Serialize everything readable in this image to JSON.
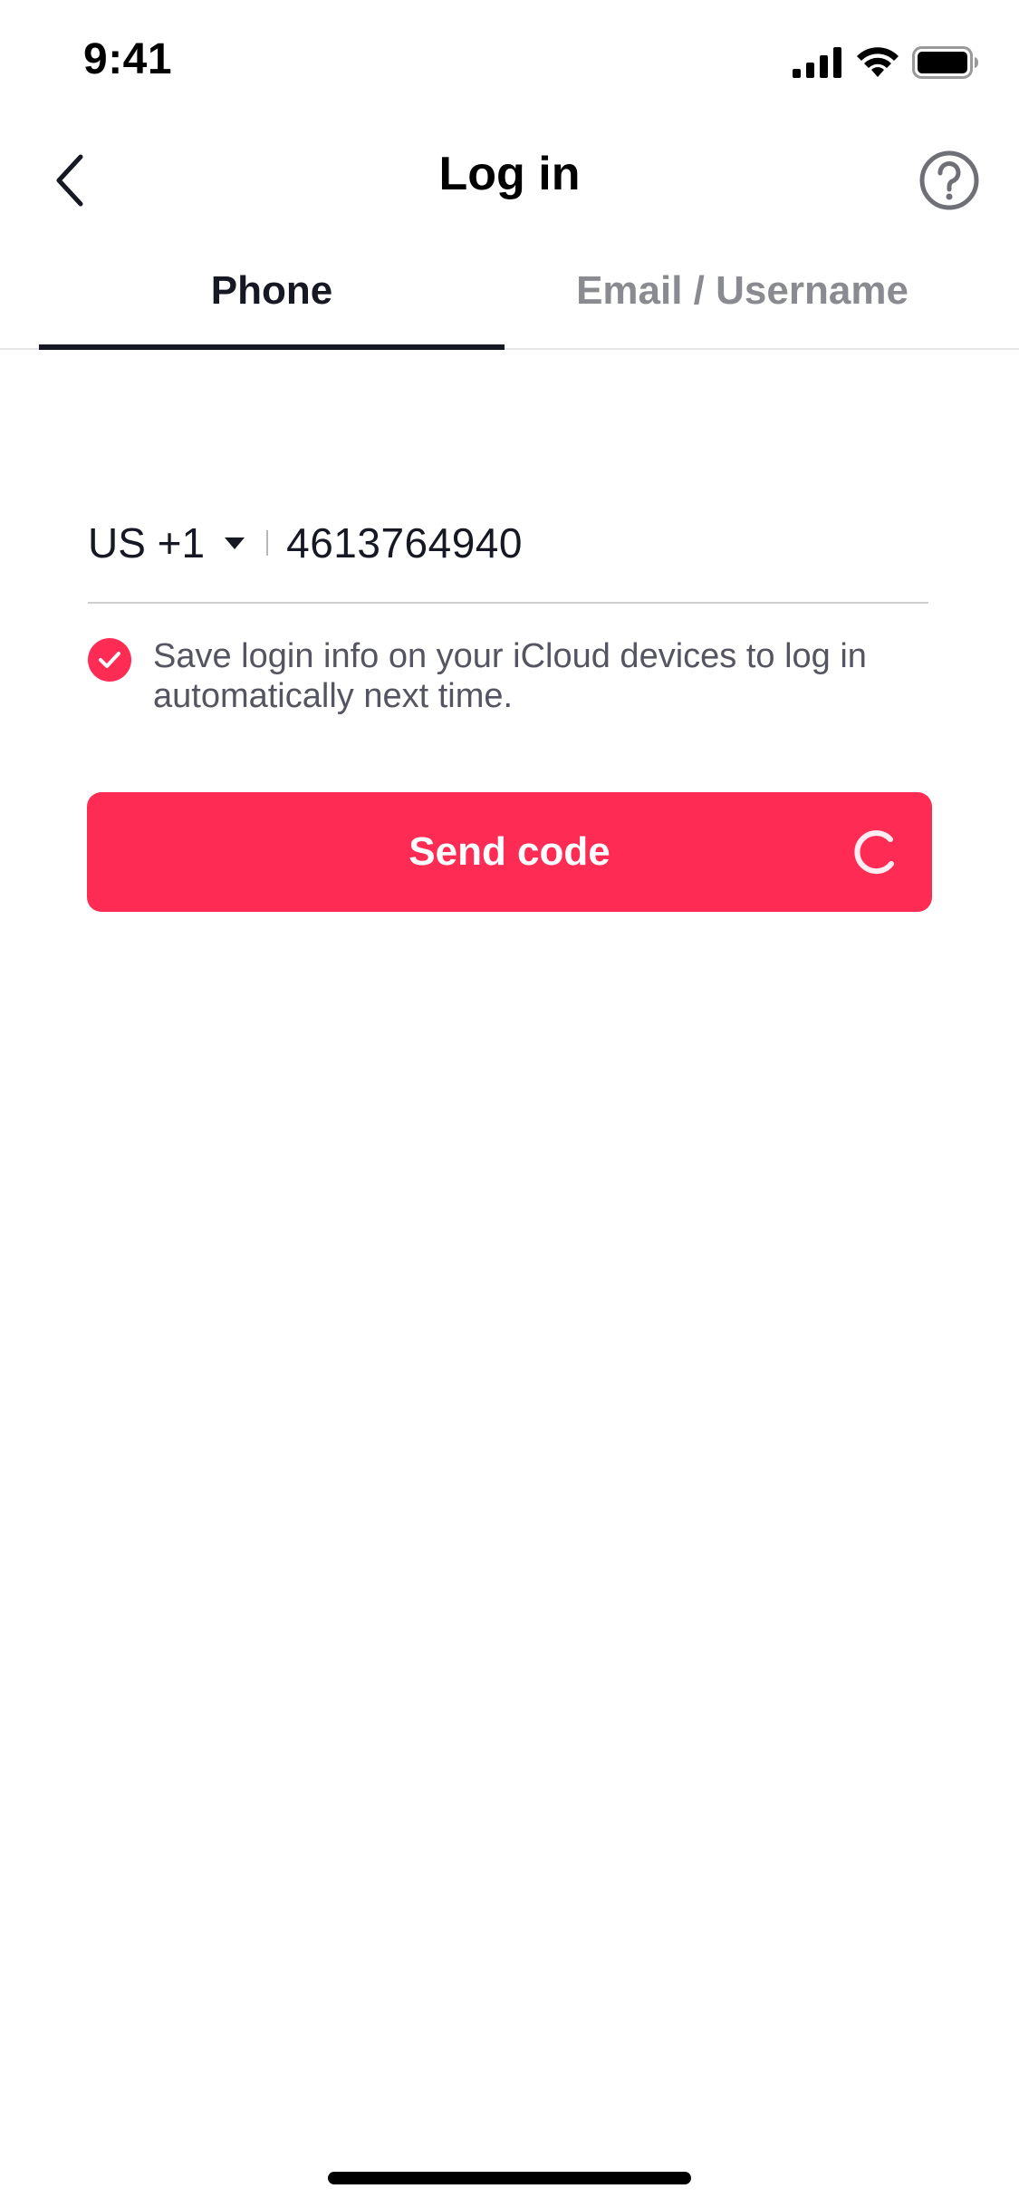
{
  "status_bar": {
    "time": "9:41",
    "icons": [
      "cellular-signal-icon",
      "wifi-icon",
      "battery-icon"
    ]
  },
  "nav": {
    "title": "Log in",
    "back_icon": "chevron-left-icon",
    "help_icon": "question-circle-icon"
  },
  "tabs": [
    {
      "label": "Phone",
      "active": true
    },
    {
      "label": "Email / Username",
      "active": false
    }
  ],
  "phone_form": {
    "country_code": "US +1",
    "phone_number": "4613764940"
  },
  "save_login": {
    "checked": true,
    "text": "Save login info on your iCloud devices to log in automatically next time."
  },
  "send_button": {
    "label": "Send code",
    "loading": true
  },
  "colors": {
    "accent": "#fe2c55",
    "text_primary": "#161823",
    "text_secondary": "#8a8b91"
  }
}
